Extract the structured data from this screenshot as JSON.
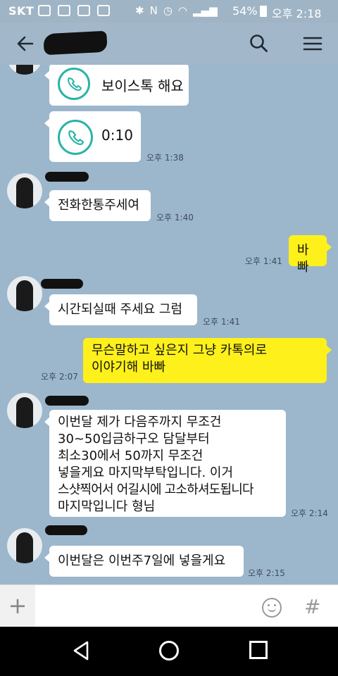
{
  "status": {
    "carrier": "SKT",
    "battery": "54%",
    "time": "오후 2:18"
  },
  "header": {
    "back_icon": "arrow-left-icon",
    "search_icon": "search-icon",
    "menu_icon": "hamburger-menu-icon"
  },
  "messages": [
    {
      "type": "voice",
      "side": "left",
      "text": "보이스톡 해요",
      "time": ""
    },
    {
      "type": "voice",
      "side": "left",
      "text": "0:10",
      "time": "오후 1:38"
    },
    {
      "type": "text",
      "side": "left",
      "text": "전화한통주세여",
      "time": "오후 1:40"
    },
    {
      "type": "text",
      "side": "right",
      "text": "바빠",
      "time": "오후 1:41"
    },
    {
      "type": "text",
      "side": "left",
      "text": "시간되실때 주세요 그럼",
      "time": "오후 1:41"
    },
    {
      "type": "text",
      "side": "right",
      "lines": [
        "무슨말하고 싶은지 그냥 카톡의로",
        "이야기해 바빠"
      ],
      "time": "오후 2:07"
    },
    {
      "type": "text",
      "side": "left",
      "lines": [
        "이번달 제가 다음주까지 무조건",
        "30~50입금하구오  담달부터",
        "최소30에서 50까지 무조건",
        "넣을게요 마지막부탁입니다. 이거",
        "스샷찍어서 어길시에 고소하셔도됩니다",
        "마지막입니다 형님"
      ],
      "time": "오후 2:14"
    },
    {
      "type": "text",
      "side": "left",
      "text": "이번달은 이번주7일에 넣을게요",
      "time": "오후 2:15"
    }
  ],
  "input": {
    "placeholder": "",
    "plus": "+",
    "hash": "#"
  },
  "colors": {
    "chat_bg": "#9cb6cc",
    "my_bubble": "#fef01b",
    "their_bubble": "#ffffff",
    "voice_accent": "#2bb3a8"
  }
}
